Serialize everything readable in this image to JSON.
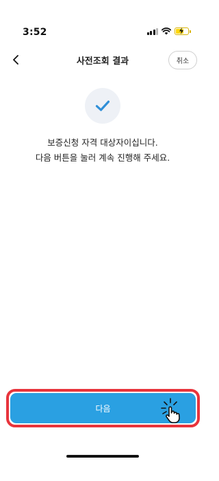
{
  "status_bar": {
    "time": "3:52"
  },
  "nav": {
    "title": "사전조회 결과",
    "cancel_label": "취소"
  },
  "result": {
    "line1": "보증신청 자격 대상자이십니다.",
    "line2": "다음 버튼을 눌러 계속 진행해 주세요."
  },
  "footer": {
    "next_label": "다음"
  },
  "colors": {
    "primary_button": "#2aa0e2",
    "highlight_border": "#e8343c",
    "check_blue": "#2f8fd8",
    "check_bg": "#eef1f6"
  },
  "icons": [
    "back-chevron-icon",
    "check-icon",
    "signal-icon",
    "wifi-icon",
    "battery-charging-icon",
    "tap-hand-icon"
  ]
}
